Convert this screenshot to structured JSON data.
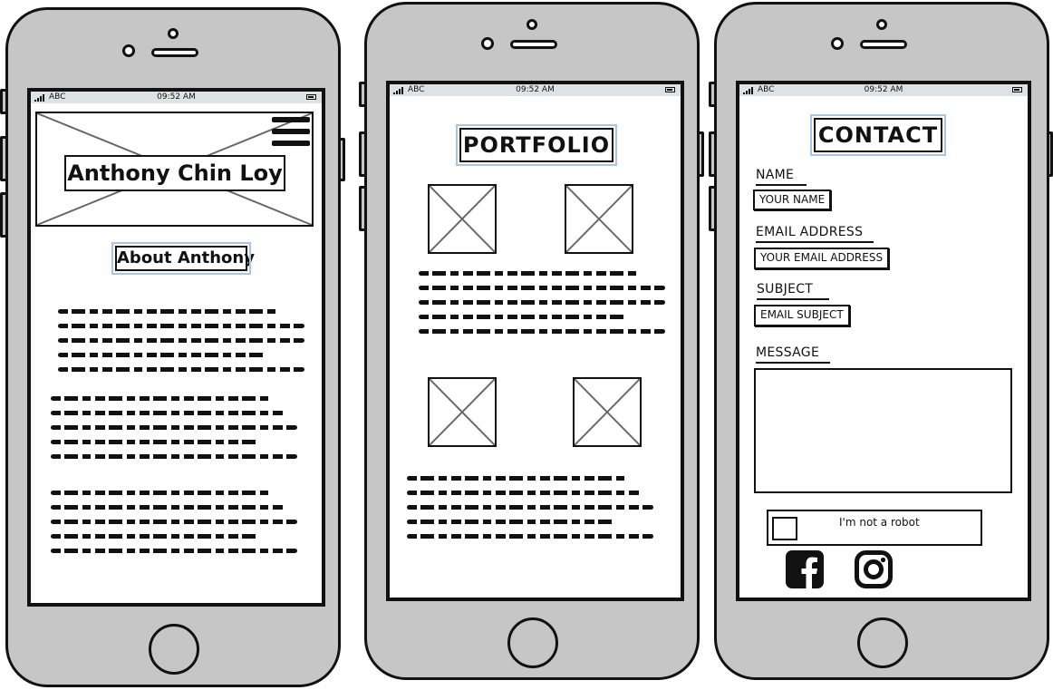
{
  "status_bar": {
    "carrier": "ABC",
    "time": "09:52 AM"
  },
  "phone1": {
    "header_title": "Anthony Chin Loy",
    "section_title": "About Anthony",
    "menu_icon": "hamburger-menu-icon",
    "image_icon": "image-placeholder-icon"
  },
  "phone2": {
    "title": "PORTFOLIO",
    "image_icon": "image-placeholder-icon"
  },
  "phone3": {
    "title": "CONTACT",
    "name_label": "NAME",
    "name_placeholder": "YOUR NAME",
    "email_label": "EMAIL ADDRESS",
    "email_placeholder": "YOUR EMAIL ADDRESS",
    "subject_label": "SUBJECT",
    "subject_placeholder": "EMAIL SUBJECT",
    "message_label": "MESSAGE",
    "captcha_label": "I'm not a robot",
    "social_icons": [
      "facebook-icon",
      "instagram-icon"
    ]
  },
  "colors": {
    "phone_body": "#c6c6c6",
    "status_bar": "#dde3e5",
    "title_highlight": "#a8c4e8",
    "outline": "#111111"
  }
}
